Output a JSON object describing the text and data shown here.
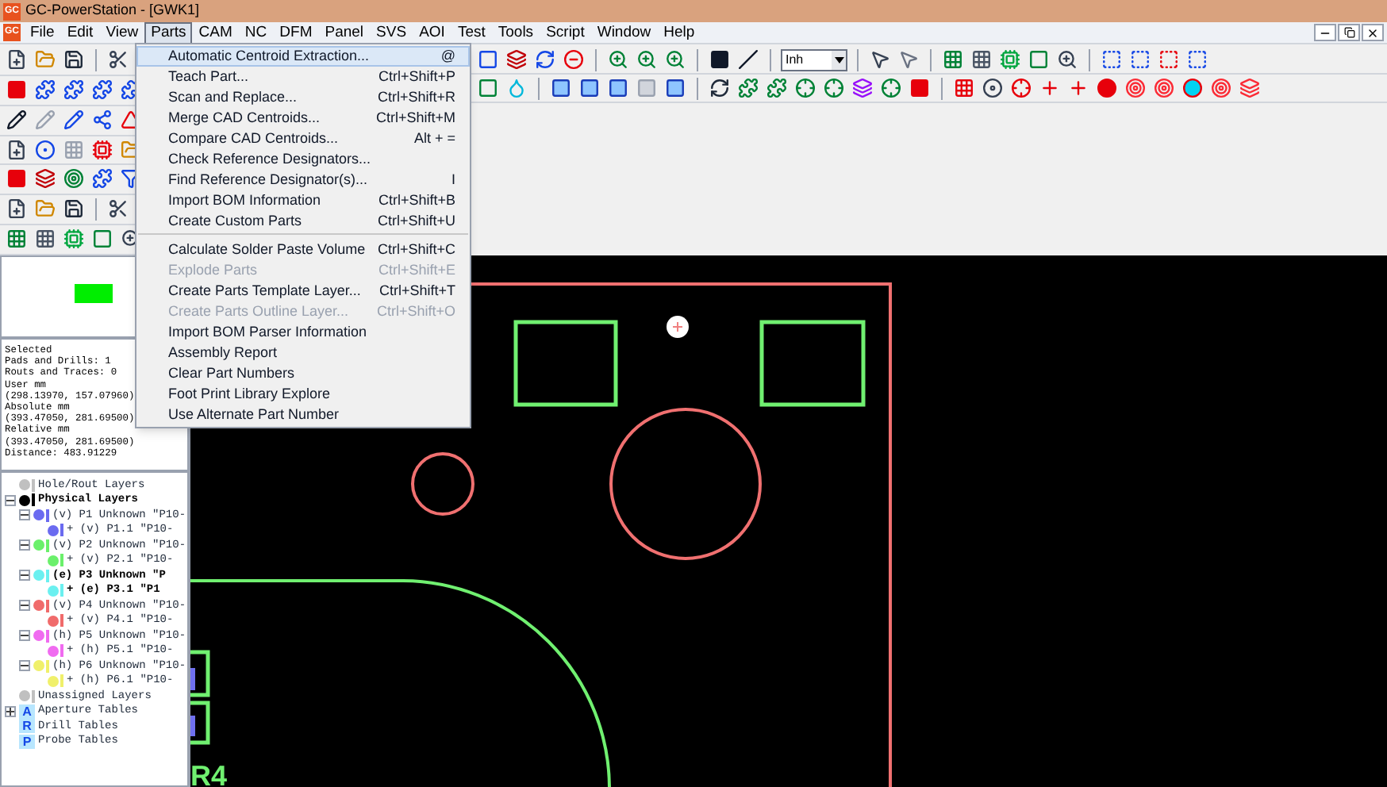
{
  "window": {
    "title": "GC-PowerStation - [GWK1]",
    "logo_text": "GC"
  },
  "menubar": {
    "logo_text": "GC",
    "items": [
      {
        "label": "File",
        "selected": false
      },
      {
        "label": "Edit",
        "selected": false
      },
      {
        "label": "View",
        "selected": false
      },
      {
        "label": "Parts",
        "selected": true
      },
      {
        "label": "CAM",
        "selected": false
      },
      {
        "label": "NC",
        "selected": false
      },
      {
        "label": "DFM",
        "selected": false
      },
      {
        "label": "Panel",
        "selected": false
      },
      {
        "label": "SVS",
        "selected": false
      },
      {
        "label": "AOI",
        "selected": false
      },
      {
        "label": "Test",
        "selected": false
      },
      {
        "label": "Tools",
        "selected": false
      },
      {
        "label": "Script",
        "selected": false
      },
      {
        "label": "Window",
        "selected": false
      },
      {
        "label": "Help",
        "selected": false
      }
    ]
  },
  "parts_menu": {
    "items": [
      {
        "label": "Automatic Centroid Extraction...",
        "shortcut": "@",
        "selected": true,
        "disabled": false,
        "separator_before": false
      },
      {
        "label": "Teach Part...",
        "shortcut": "Ctrl+Shift+P",
        "selected": false,
        "disabled": false,
        "separator_before": false
      },
      {
        "label": "Scan and Replace...",
        "shortcut": "Ctrl+Shift+R",
        "selected": false,
        "disabled": false,
        "separator_before": false
      },
      {
        "label": "Merge CAD Centroids...",
        "shortcut": "Ctrl+Shift+M",
        "selected": false,
        "disabled": false,
        "separator_before": false
      },
      {
        "label": "Compare CAD Centroids...",
        "shortcut": "Alt + =",
        "selected": false,
        "disabled": false,
        "separator_before": false
      },
      {
        "label": "Check Reference Designators...",
        "selected": false,
        "disabled": false,
        "separator_before": false
      },
      {
        "label": "Find Reference Designator(s)...",
        "shortcut": "I",
        "selected": false,
        "disabled": false,
        "separator_before": false
      },
      {
        "label": "Import BOM Information",
        "shortcut": "Ctrl+Shift+B",
        "selected": false,
        "disabled": false,
        "separator_before": false
      },
      {
        "label": "Create Custom Parts",
        "shortcut": "Ctrl+Shift+U",
        "selected": false,
        "disabled": false,
        "separator_before": false
      },
      {
        "label": "Calculate Solder Paste Volume",
        "shortcut": "Ctrl+Shift+C",
        "selected": false,
        "disabled": false,
        "separator_before": true
      },
      {
        "label": "Explode Parts",
        "shortcut": "Ctrl+Shift+E",
        "selected": false,
        "disabled": true,
        "separator_before": false
      },
      {
        "label": "Create Parts Template Layer...",
        "shortcut": "Ctrl+Shift+T",
        "selected": false,
        "disabled": false,
        "separator_before": false
      },
      {
        "label": "Create Parts Outline Layer...",
        "shortcut": "Ctrl+Shift+O",
        "selected": false,
        "disabled": true,
        "separator_before": false
      },
      {
        "label": "Import BOM Parser Information",
        "selected": false,
        "disabled": false,
        "separator_before": false
      },
      {
        "label": "Assembly Report",
        "selected": false,
        "disabled": false,
        "separator_before": false
      },
      {
        "label": "Clear Part Numbers",
        "selected": false,
        "disabled": false,
        "separator_before": false
      },
      {
        "label": "Foot Print Library Explore",
        "selected": false,
        "disabled": false,
        "separator_before": false
      },
      {
        "label": "Use Alternate Part Number",
        "selected": false,
        "disabled": false,
        "separator_before": false
      }
    ]
  },
  "toolbar": {
    "units_dropdown": "Inh"
  },
  "info_panel": {
    "lines": [
      "Selected",
      "Pads and Drills: 1",
      "Routs and Traces: 0",
      "User mm",
      "(298.13970, 157.07960)",
      "Absolute mm",
      "(393.47050, 281.69500)",
      "Relative mm",
      "(393.47050, 281.69500)",
      "Distance: 483.91229"
    ]
  },
  "layer_tree": [
    {
      "label": "Hole/Rout Layers",
      "kind": "group",
      "bold": false
    },
    {
      "label": "Physical Layers",
      "kind": "group",
      "bold": true,
      "expanded": true,
      "children": [
        {
          "label": "(v) P1 Unknown \"P10-",
          "kind": "layer",
          "bold": false,
          "expanded": true,
          "color": "#6b6bf0",
          "children": [
            {
              "label": "+ (v) P1.1 \"P10-",
              "kind": "layer",
              "bold": false,
              "color": "#6b6bf0"
            }
          ]
        },
        {
          "label": "(v) P2 Unknown \"P10-",
          "kind": "layer",
          "bold": false,
          "expanded": true,
          "color": "#6bf06b",
          "children": [
            {
              "label": "+ (v) P2.1 \"P10-",
              "kind": "layer",
              "bold": false,
              "color": "#6bf06b"
            }
          ]
        },
        {
          "label": "(e) P3 Unknown \"P",
          "kind": "layer",
          "bold": true,
          "expanded": true,
          "color": "#6bf0f0",
          "children": [
            {
              "label": "+ (e) P3.1 \"P1",
              "kind": "layer",
              "bold": true,
              "color": "#6bf0f0"
            }
          ]
        },
        {
          "label": "(v) P4 Unknown \"P10-",
          "kind": "layer",
          "bold": false,
          "expanded": true,
          "color": "#f06b6b",
          "children": [
            {
              "label": "+ (v) P4.1 \"P10-",
              "kind": "layer",
              "bold": false,
              "color": "#f06b6b"
            }
          ]
        },
        {
          "label": "(h) P5 Unknown \"P10-",
          "kind": "layer",
          "bold": false,
          "expanded": true,
          "color": "#f06bf0",
          "children": [
            {
              "label": "+ (h) P5.1 \"P10-",
              "kind": "layer",
              "bold": false,
              "color": "#f06bf0"
            }
          ]
        },
        {
          "label": "(h) P6 Unknown \"P10-",
          "kind": "layer",
          "bold": false,
          "expanded": true,
          "color": "#f0f06b",
          "children": [
            {
              "label": "+ (h) P6.1 \"P10-",
              "kind": "layer",
              "bold": false,
              "color": "#f0f06b"
            }
          ]
        }
      ]
    },
    {
      "label": "Unassigned Layers",
      "kind": "group",
      "bold": false
    },
    {
      "label": "Aperture Tables",
      "kind": "table",
      "icon_letter": "A",
      "bold": false,
      "expanded": false
    },
    {
      "label": "Drill Tables",
      "kind": "table",
      "icon_letter": "R",
      "bold": false
    },
    {
      "label": "Probe Tables",
      "kind": "table",
      "icon_letter": "P",
      "bold": false
    }
  ],
  "canvas": {
    "labels": [
      "R4"
    ]
  }
}
